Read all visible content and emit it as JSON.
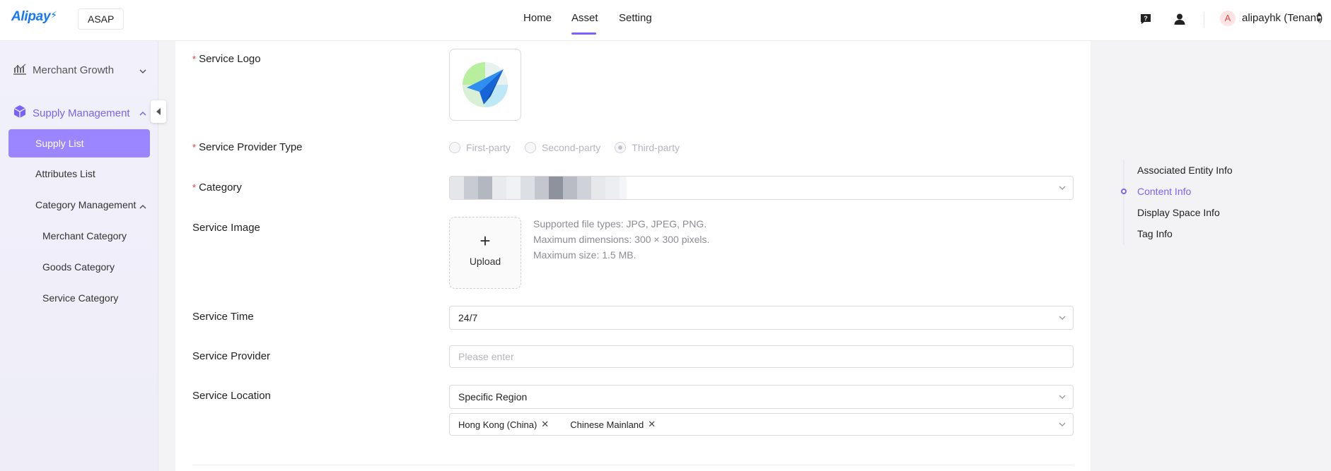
{
  "header": {
    "logo_text": "Alipay",
    "app_name": "ASAP",
    "nav": [
      {
        "label": "Home"
      },
      {
        "label": "Asset"
      },
      {
        "label": "Setting"
      }
    ],
    "active_nav": "Asset",
    "avatar_letter": "A",
    "tenant": "alipayhk (Tenant)"
  },
  "sidebar": {
    "groups": [
      {
        "label": "Merchant Growth",
        "expanded": false
      },
      {
        "label": "Supply Management",
        "expanded": true
      }
    ],
    "items": [
      {
        "label": "Supply List",
        "active": true
      },
      {
        "label": "Attributes List"
      },
      {
        "label": "Category Management"
      },
      {
        "label": "Merchant Category"
      },
      {
        "label": "Goods Category"
      },
      {
        "label": "Service Category"
      }
    ],
    "accent_color": "#7b61ff"
  },
  "form": {
    "service_logo_label": "Service Logo",
    "provider_type_label": "Service Provider Type",
    "provider_types": [
      "First-party",
      "Second-party",
      "Third-party"
    ],
    "provider_type_selected": "Third-party",
    "category_label": "Category",
    "service_image_label": "Service Image",
    "upload_label": "Upload",
    "upload_hints": [
      "Supported file types: JPG, JPEG, PNG.",
      "Maximum dimensions: 300 × 300 pixels.",
      "Maximum size: 1.5 MB."
    ],
    "service_time_label": "Service Time",
    "service_time_value": "24/7",
    "service_provider_label": "Service Provider",
    "service_provider_placeholder": "Please enter",
    "service_location_label": "Service Location",
    "service_location_value": "Specific Region",
    "regions": [
      "Hong Kong (China)",
      "Chinese Mainland"
    ]
  },
  "anchor_nav": {
    "items": [
      "Associated Entity Info",
      "Content Info",
      "Display Space Info",
      "Tag Info"
    ],
    "active": "Content Info"
  }
}
